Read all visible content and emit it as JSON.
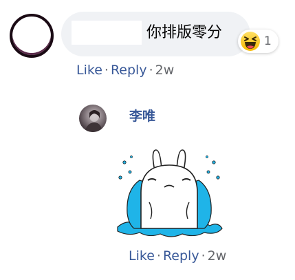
{
  "comment": {
    "text": "你排版零分",
    "reaction": {
      "icon": "haha-emoji-icon",
      "count": "1"
    },
    "actions": {
      "like": "Like",
      "sep1": "·",
      "reply": "Reply",
      "sep2": "·",
      "time": "2w"
    }
  },
  "reply": {
    "author": "李唯",
    "sticker": "crying-rabbit-sticker",
    "actions": {
      "like": "Like",
      "sep1": "·",
      "reply": "Reply",
      "sep2": "·",
      "time": "2w"
    }
  },
  "colors": {
    "link": "#385898",
    "bubble": "#f0f2f5",
    "meta": "#65676b",
    "tears": "#1fb4e8"
  }
}
